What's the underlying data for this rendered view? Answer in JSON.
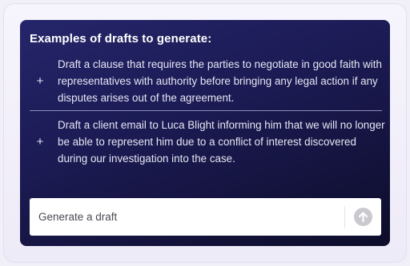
{
  "panel": {
    "title": "Examples of drafts to generate:",
    "examples": [
      {
        "icon": "plus-icon",
        "line1": "Draft a clause that requires the parties to negotiate in good faith with",
        "line2": "representatives with authority before bringing any legal action if any",
        "line3": "disputes arises out of the agreement."
      },
      {
        "icon": "plus-icon",
        "line1": "Draft a client email to Luca Blight informing him that we will no longer",
        "line2": "be able to represent him due to a conflict of interest discovered",
        "line3": "during our investigation into the case."
      }
    ]
  },
  "input": {
    "placeholder": "Generate a draft",
    "send_icon": "arrow-up-icon"
  },
  "colors": {
    "panel_bg": "#1c1b55",
    "send_button": "#c9c9cf",
    "text": "#e6e6f4"
  }
}
